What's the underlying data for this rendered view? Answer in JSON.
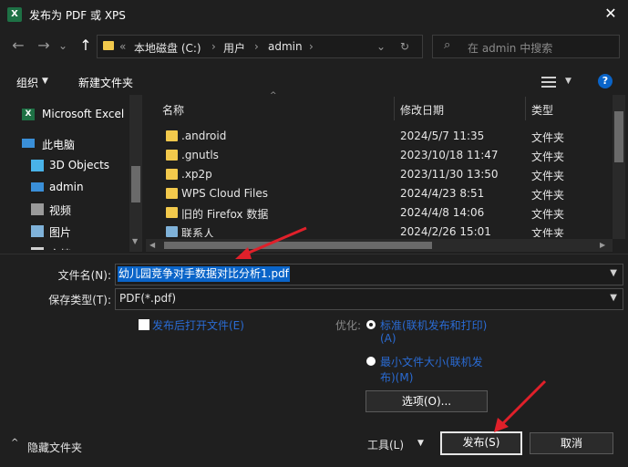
{
  "window": {
    "title": "发布为 PDF 或 XPS",
    "app_icon_letter": "X",
    "close_glyph": "✕"
  },
  "nav": {
    "back": "←",
    "forward": "→",
    "dropdown": "⌄",
    "up": "↑",
    "refresh": "↻"
  },
  "address": {
    "chevron": "«",
    "crumbs": [
      "本地磁盘 (C:)",
      "用户",
      "admin"
    ],
    "separator": "›"
  },
  "search": {
    "placeholder": "在 admin 中搜索",
    "icon": "⌕"
  },
  "toolbar": {
    "organize": "组织",
    "new_folder": "新建文件夹",
    "help": "?"
  },
  "sidebar": {
    "items": [
      {
        "label": "Microsoft Excel",
        "icon": "excel-icon"
      },
      {
        "label": "此电脑",
        "icon": "computer-icon"
      },
      {
        "label": "3D Objects",
        "icon": "3d-objects-icon"
      },
      {
        "label": "admin",
        "icon": "user-folder-icon"
      },
      {
        "label": "视频",
        "icon": "video-icon"
      },
      {
        "label": "图片",
        "icon": "picture-icon"
      },
      {
        "label": "文档",
        "icon": "document-icon"
      }
    ]
  },
  "files": {
    "columns": [
      "名称",
      "修改日期",
      "类型"
    ],
    "rows": [
      {
        "name": ".android",
        "date": "2024/5/7 11:35",
        "type": "文件夹"
      },
      {
        "name": ".gnutls",
        "date": "2023/10/18 11:47",
        "type": "文件夹"
      },
      {
        "name": ".xp2p",
        "date": "2023/11/30 13:50",
        "type": "文件夹"
      },
      {
        "name": "WPS Cloud Files",
        "date": "2024/4/23 8:51",
        "type": "文件夹"
      },
      {
        "name": "旧的 Firefox 数据",
        "date": "2024/4/8 14:06",
        "type": "文件夹"
      },
      {
        "name": "联系人",
        "date": "2024/2/26 15:01",
        "type": "文件夹"
      }
    ]
  },
  "form": {
    "filename_label": "文件名(N):",
    "filename_value": "幼儿园竞争对手数据对比分析1.pdf",
    "type_label": "保存类型(T):",
    "type_value": "PDF(*.pdf)",
    "open_after": "发布后打开文件(E)",
    "optimize_label": "优化:",
    "opt_standard_1": "标准(联机发布和打印)",
    "opt_standard_2": "(A)",
    "opt_min_1": "最小文件大小(联机发",
    "opt_min_2": "布)(M)",
    "options_button": "选项(O)..."
  },
  "footer": {
    "hide_folders": "隐藏文件夹",
    "tools": "工具(L)",
    "publish": "发布(S)",
    "cancel": "取消"
  },
  "colors": {
    "accent": "#0a64c8",
    "link": "#2a6bd3",
    "annotation_arrow": "#e0202a",
    "folder": "#f2c94c"
  }
}
